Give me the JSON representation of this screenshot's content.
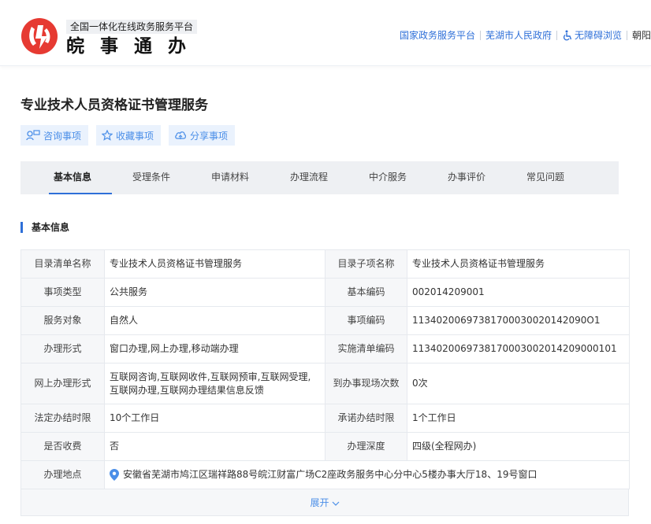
{
  "header": {
    "platform_subtitle": "全国一体化在线政务服务平台",
    "brand_name": "皖事通办",
    "links": {
      "national": "国家政务服务平台",
      "city": "芜湖市人民政府",
      "accessibility": "无障碍浏览",
      "reading": "朝阳"
    },
    "brand_color": "#e63a32",
    "link_color": "#2e6fd8"
  },
  "page": {
    "title": "专业技术人员资格证书管理服务",
    "actions": {
      "consult": "咨询事项",
      "favorite": "收藏事项",
      "share": "分享事项"
    }
  },
  "tabs": [
    {
      "label": "基本信息",
      "active": true
    },
    {
      "label": "受理条件",
      "active": false
    },
    {
      "label": "申请材料",
      "active": false
    },
    {
      "label": "办理流程",
      "active": false
    },
    {
      "label": "中介服务",
      "active": false
    },
    {
      "label": "办事评价",
      "active": false
    },
    {
      "label": "常见问题",
      "active": false
    }
  ],
  "basic_info": {
    "section_title": "基本信息",
    "rows": [
      {
        "k1": "目录清单名称",
        "v1": "专业技术人员资格证书管理服务",
        "k2": "目录子项名称",
        "v2": "专业技术人员资格证书管理服务"
      },
      {
        "k1": "事项类型",
        "v1": "公共服务",
        "k2": "基本编码",
        "v2": "002014209001"
      },
      {
        "k1": "服务对象",
        "v1": "自然人",
        "k2": "事项编码",
        "v2": "11340200697381700030020142090O1"
      },
      {
        "k1": "办理形式",
        "v1": "窗口办理,网上办理,移动端办理",
        "k2": "实施清单编码",
        "v2": "1134020069738170003002014209000101"
      },
      {
        "k1": "网上办理形式",
        "v1": "互联网咨询,互联网收件,互联网预审,互联网受理,互联网办理,互联网办理结果信息反馈",
        "k2": "到办事现场次数",
        "v2": "0次"
      },
      {
        "k1": "法定办结时限",
        "v1": "10个工作日",
        "k2": "承诺办结时限",
        "v2": "1个工作日"
      },
      {
        "k1": "是否收费",
        "v1": "否",
        "k2": "办理深度",
        "v2": "四级(全程网办)"
      }
    ],
    "location_label": "办理地点",
    "location_value": "安徽省芜湖市鸠江区瑞祥路88号皖江财富广场C2座政务服务中心分中心5楼办事大厅18、19号窗口",
    "expand_label": "展开"
  }
}
